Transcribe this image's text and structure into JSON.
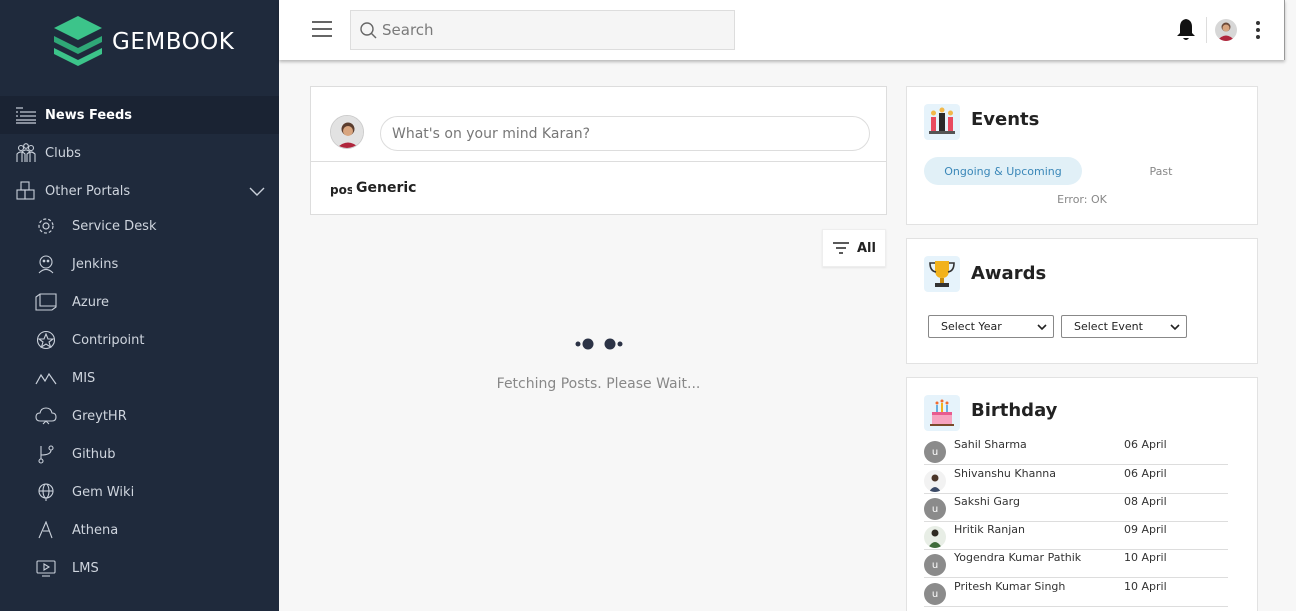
{
  "brand": {
    "name": "GEMBOOK"
  },
  "sidebar": {
    "items": [
      {
        "label": "News Feeds",
        "icon": "news-icon",
        "active": true
      },
      {
        "label": "Clubs",
        "icon": "clubs-icon"
      },
      {
        "label": "Other Portals",
        "icon": "portals-icon"
      },
      {
        "label": "Service Desk",
        "icon": "gear-icon"
      },
      {
        "label": "Jenkins",
        "icon": "jenkins-icon"
      },
      {
        "label": "Azure",
        "icon": "azure-icon"
      },
      {
        "label": "Contripoint",
        "icon": "contripoint-icon"
      },
      {
        "label": "MIS",
        "icon": "mis-icon"
      },
      {
        "label": "GreytHR",
        "icon": "cloud-icon"
      },
      {
        "label": "Github",
        "icon": "git-branch-icon"
      },
      {
        "label": "Gem Wiki",
        "icon": "globe-icon"
      },
      {
        "label": "Athena",
        "icon": "athena-icon"
      },
      {
        "label": "LMS",
        "icon": "lms-icon"
      }
    ]
  },
  "header": {
    "search_placeholder": "Search"
  },
  "composer": {
    "placeholder": "What's on your mind Karan?",
    "tab_prefix": "pos",
    "tab_label": "Generic"
  },
  "feed": {
    "filter_label": "All",
    "loading_text": "Fetching Posts. Please Wait..."
  },
  "events": {
    "title": "Events",
    "tab_active": "Ongoing & Upcoming",
    "tab_inactive": "Past",
    "error": "Error: OK"
  },
  "awards": {
    "title": "Awards",
    "year_select": "Select Year",
    "event_select": "Select Event"
  },
  "birthday": {
    "title": "Birthday",
    "rows": [
      {
        "name": "Sahil Sharma",
        "date": "06 April",
        "initial": "u",
        "photo": false
      },
      {
        "name": "Shivanshu Khanna",
        "date": "06 April",
        "initial": "",
        "photo": true
      },
      {
        "name": "Sakshi Garg",
        "date": "08 April",
        "initial": "u",
        "photo": false
      },
      {
        "name": "Hritik Ranjan",
        "date": "09 April",
        "initial": "",
        "photo": true
      },
      {
        "name": "Yogendra Kumar Pathik",
        "date": "10 April",
        "initial": "u",
        "photo": false
      },
      {
        "name": "Pritesh Kumar Singh",
        "date": "10 April",
        "initial": "u",
        "photo": false
      }
    ]
  },
  "colors": {
    "sidebar_bg": "#1f2a3c",
    "accent": "#3a87b8",
    "logo_green": "#3cc48a"
  }
}
